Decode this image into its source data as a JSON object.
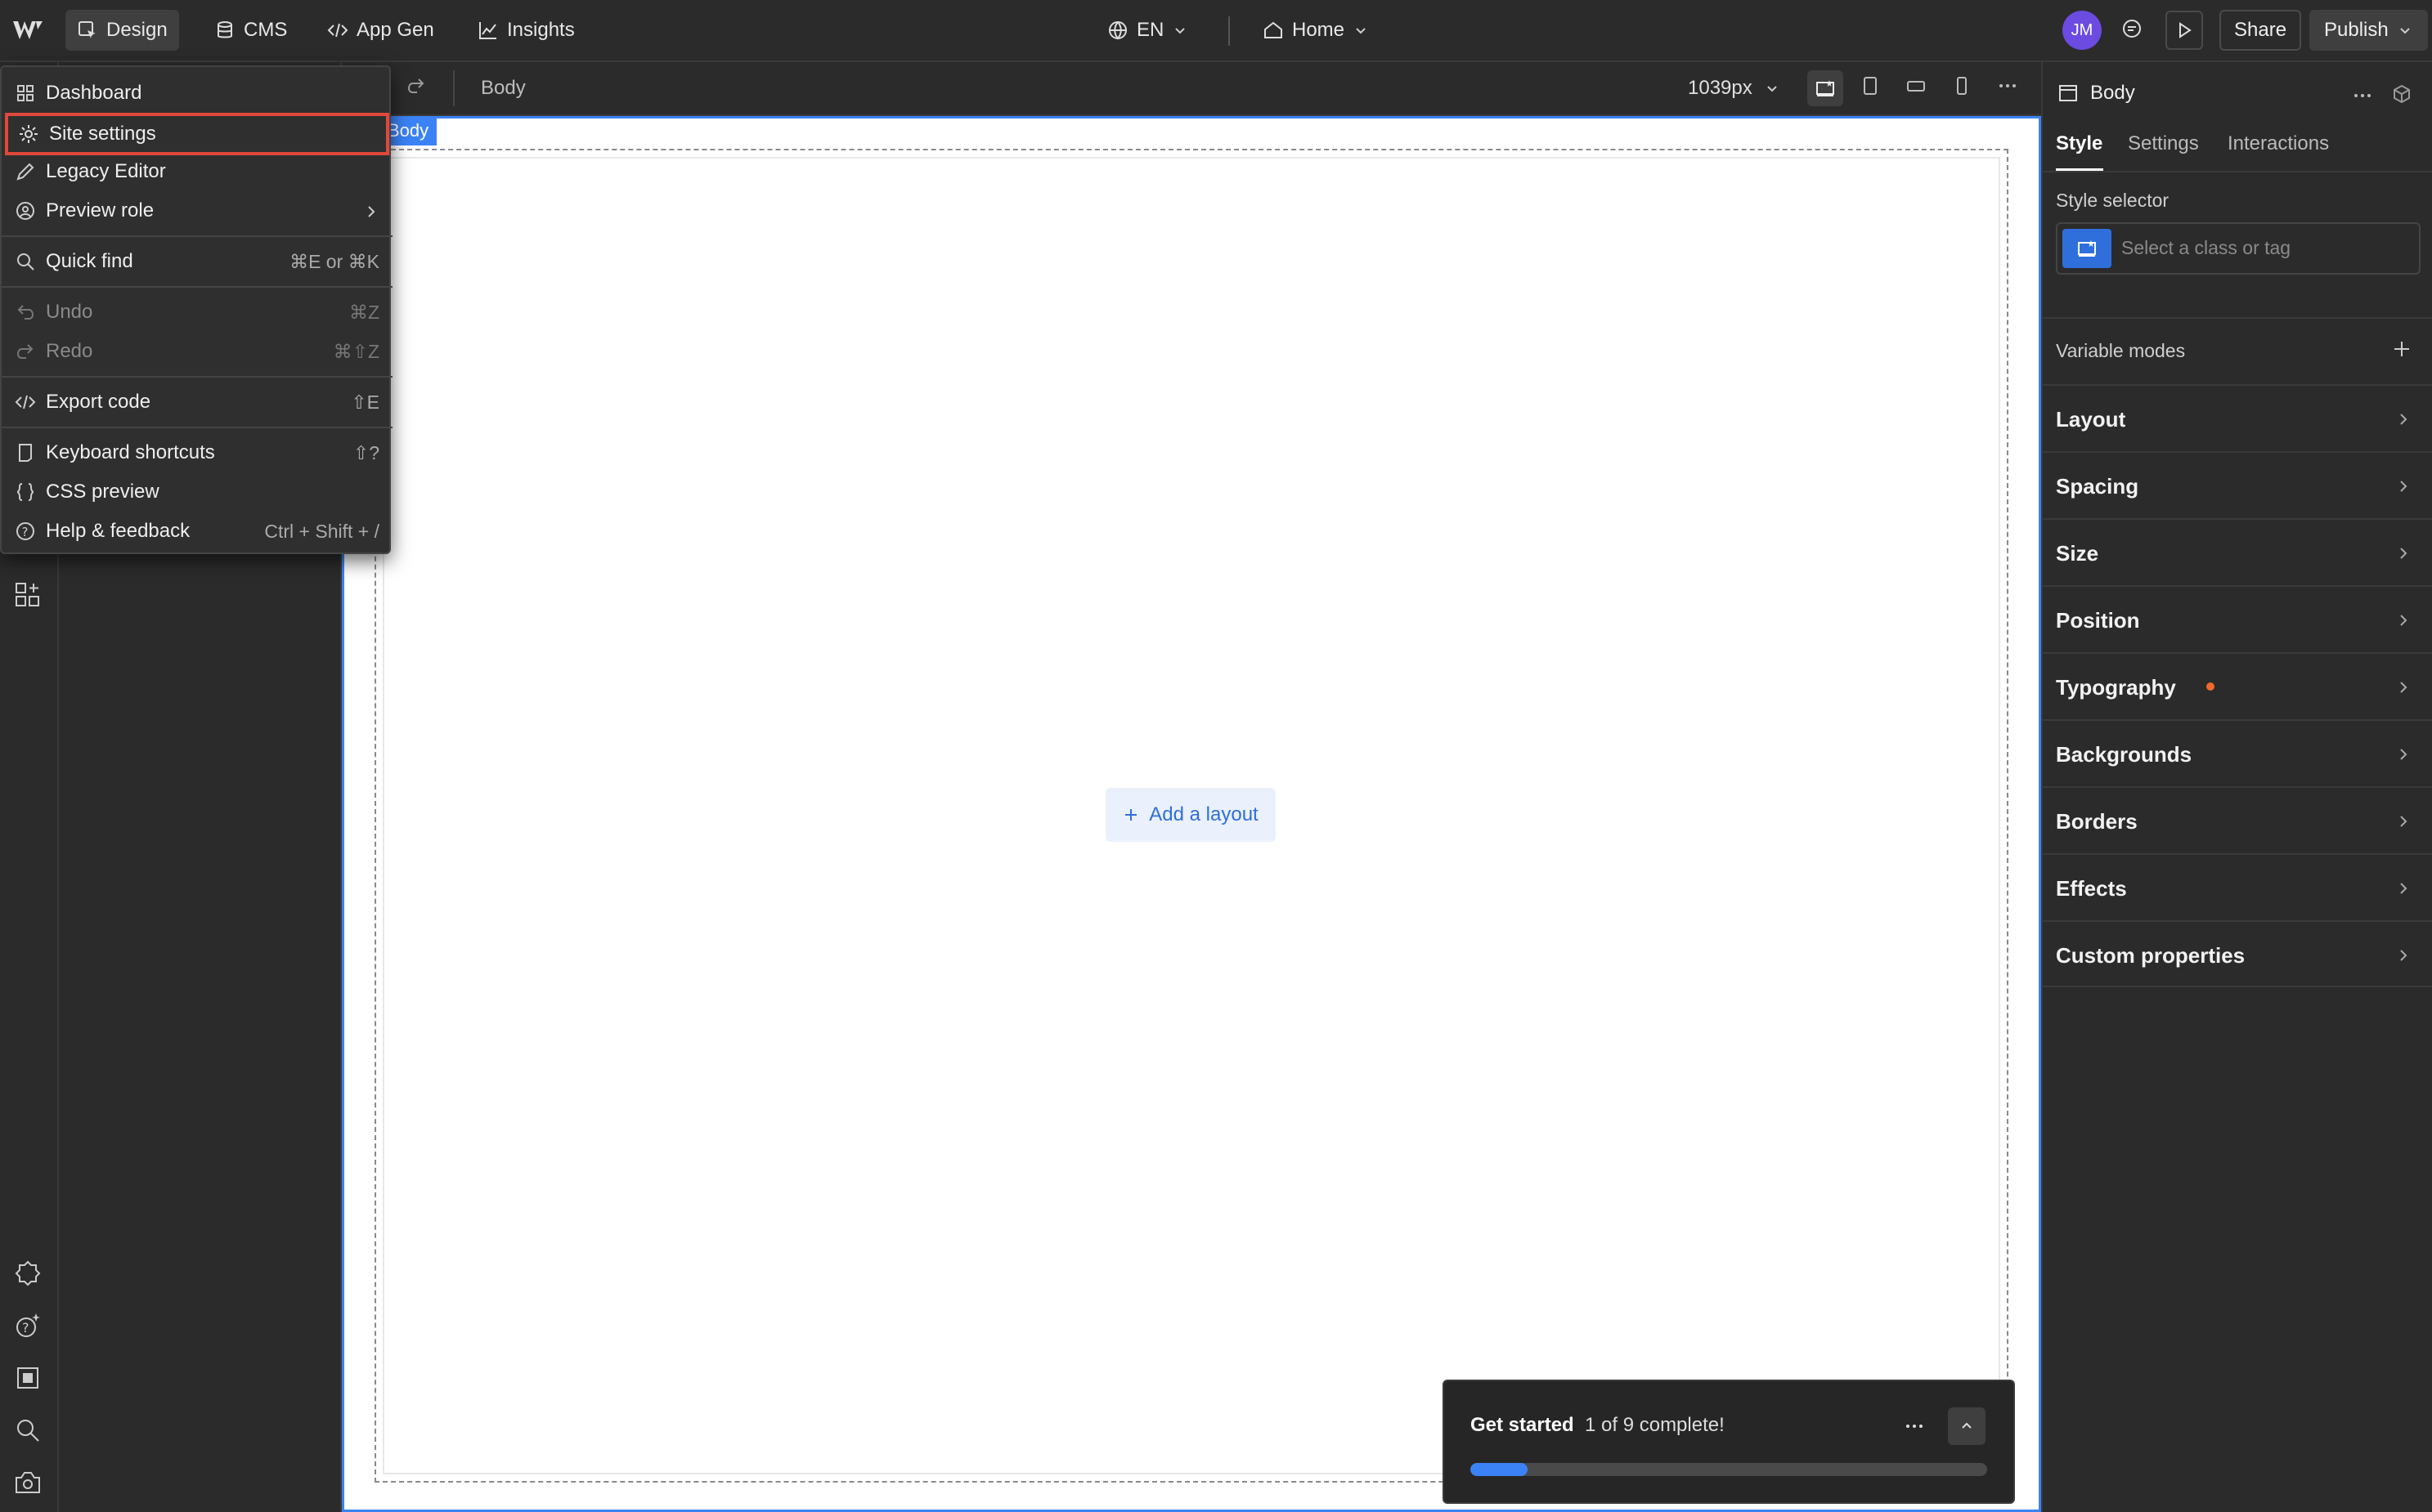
{
  "topbar": {
    "tabs": [
      {
        "label": "Design",
        "icon": "cursor-box-icon"
      },
      {
        "label": "CMS",
        "icon": "database-icon"
      },
      {
        "label": "App Gen",
        "icon": "code-icon"
      },
      {
        "label": "Insights",
        "icon": "chart-line-icon"
      }
    ],
    "locale": "EN",
    "page": "Home",
    "avatar_initials": "JM",
    "share_label": "Share",
    "publish_label": "Publish"
  },
  "menu": {
    "items": [
      {
        "label": "Dashboard",
        "shortcut": "",
        "icon": "grid-icon"
      },
      {
        "label": "Site settings",
        "shortcut": "",
        "icon": "gear-icon",
        "highlighted": true
      },
      {
        "label": "Legacy Editor",
        "shortcut": "",
        "icon": "pencil-icon"
      },
      {
        "label": "Preview role",
        "shortcut": "",
        "icon": "role-icon",
        "submenu": true
      },
      {
        "label": "Quick find",
        "shortcut": "⌘E or ⌘K",
        "icon": "search-icon"
      },
      {
        "label": "Undo",
        "shortcut": "⌘Z",
        "icon": "undo-icon",
        "disabled": true
      },
      {
        "label": "Redo",
        "shortcut": "⌘⇧Z",
        "icon": "redo-icon",
        "disabled": true
      },
      {
        "label": "Export code",
        "shortcut": "⇧E",
        "icon": "code-icon"
      },
      {
        "label": "Keyboard shortcuts",
        "shortcut": "⇧?",
        "icon": "keyboard-icon"
      },
      {
        "label": "CSS preview",
        "shortcut": "",
        "icon": "braces-icon"
      },
      {
        "label": "Help & feedback",
        "shortcut": "Ctrl + Shift + /",
        "icon": "help-icon"
      }
    ]
  },
  "canvas_bar": {
    "breadcrumb": "Body",
    "breakpoint": "1039px"
  },
  "canvas": {
    "element_tag": "Body",
    "add_layout_label": "Add a layout"
  },
  "right_panel": {
    "element": "Body",
    "tabs": [
      "Style",
      "Settings",
      "Interactions"
    ],
    "style_selector_label": "Style selector",
    "style_selector_placeholder": "Select a class or tag",
    "variable_modes_label": "Variable modes",
    "sections": [
      "Layout",
      "Spacing",
      "Size",
      "Position",
      "Typography",
      "Backgrounds",
      "Borders",
      "Effects",
      "Custom properties"
    ]
  },
  "get_started": {
    "title": "Get started",
    "status": "1 of 9 complete!",
    "progress": 0.111
  },
  "colors": {
    "accent": "#3b82f6",
    "highlight_border": "#e0483a",
    "modified_dot": "#f06a2a",
    "avatar": "#6b4be0"
  }
}
